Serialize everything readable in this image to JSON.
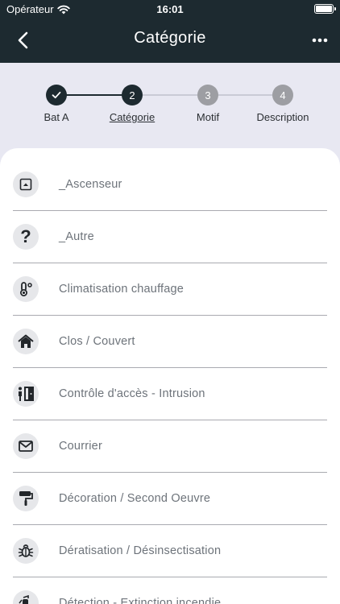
{
  "status_bar": {
    "carrier": "Opérateur",
    "time": "16:01"
  },
  "header": {
    "title": "Catégorie"
  },
  "stepper": {
    "steps": [
      {
        "number": "1",
        "label": "Bat A"
      },
      {
        "number": "2",
        "label": "Catégorie"
      },
      {
        "number": "3",
        "label": "Motif"
      },
      {
        "number": "4",
        "label": "Description"
      }
    ],
    "current_step": 2
  },
  "categories": [
    {
      "label": "_Ascenseur",
      "icon": "elevator-icon"
    },
    {
      "label": "_Autre",
      "icon": "question-mark-icon"
    },
    {
      "label": "Climatisation chauffage",
      "icon": "thermometer-icon"
    },
    {
      "label": "Clos / Couvert",
      "icon": "house-icon"
    },
    {
      "label": "Contrôle d'accès - Intrusion",
      "icon": "door-access-icon"
    },
    {
      "label": "Courrier",
      "icon": "envelope-icon"
    },
    {
      "label": "Décoration / Second Oeuvre",
      "icon": "paint-roller-icon"
    },
    {
      "label": "Dératisation / Désinsectisation",
      "icon": "bug-icon"
    },
    {
      "label": "Détection - Extinction incendie",
      "icon": "fire-extinguisher-icon"
    }
  ],
  "colors": {
    "header_bg": "#1d2a30",
    "step_done": "#1d2a30",
    "step_todo": "#9d9ea3",
    "page_bg": "#e8e8f2",
    "item_text": "#6d737a"
  }
}
